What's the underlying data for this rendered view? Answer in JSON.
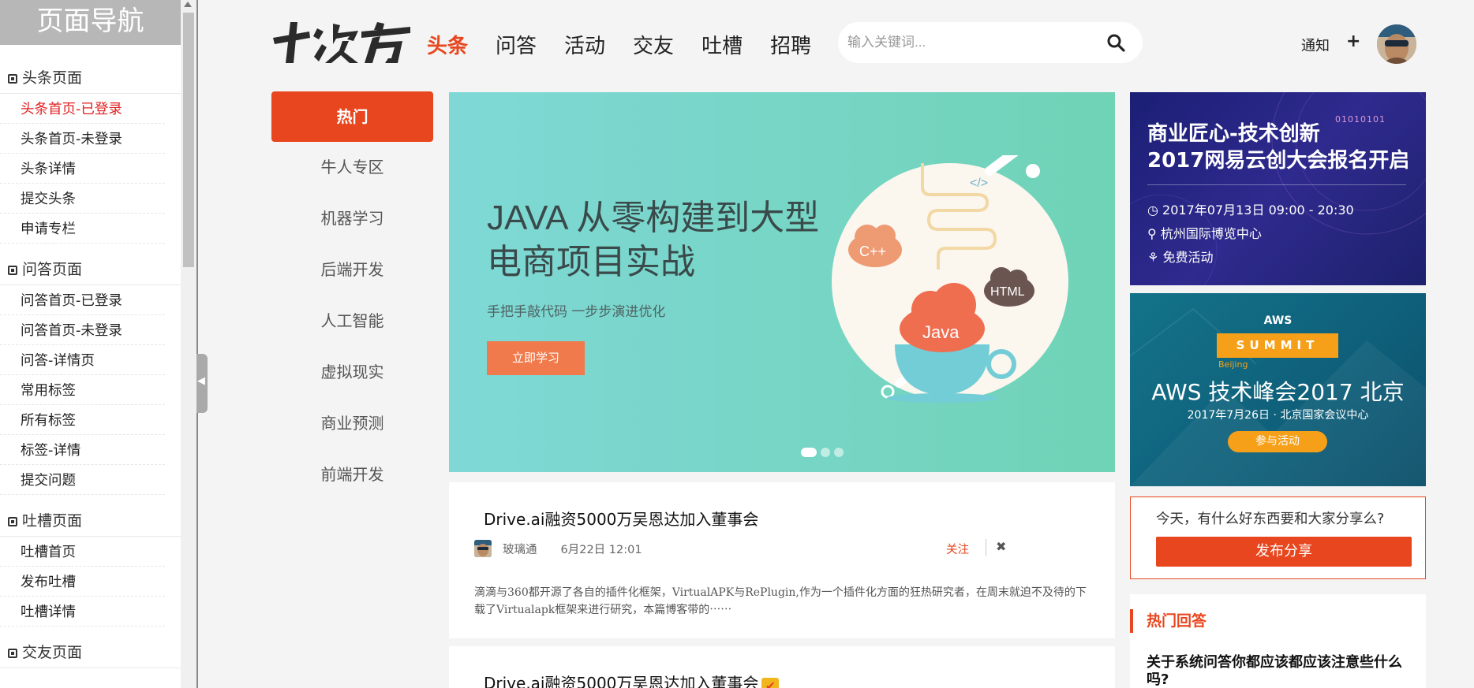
{
  "sidenav": {
    "title": "页面导航",
    "sections": [
      {
        "title": "头条页面",
        "items": [
          "头条首页-已登录",
          "头条首页-未登录",
          "头条详情",
          "提交头条",
          "申请专栏"
        ]
      },
      {
        "title": "问答页面",
        "items": [
          "问答首页-已登录",
          "问答首页-未登录",
          "问答-详情页",
          "常用标签",
          "所有标签",
          "标签-详情",
          "提交问题"
        ]
      },
      {
        "title": "吐槽页面",
        "items": [
          "吐槽首页",
          "发布吐槽",
          "吐槽详情"
        ]
      },
      {
        "title": "交友页面"
      }
    ]
  },
  "header": {
    "logo_text": "十次方",
    "nav": [
      "头条",
      "问答",
      "活动",
      "交友",
      "吐槽",
      "招聘"
    ],
    "search_placeholder": "输入关键词...",
    "notify": "通知",
    "plus": "+"
  },
  "categories": {
    "hot": "热门",
    "items": [
      "牛人专区",
      "机器学习",
      "后端开发",
      "人工智能",
      "虚拟现实",
      "商业预测",
      "前端开发"
    ]
  },
  "banner": {
    "title_line1": "JAVA 从零构建到大型",
    "title_line2": "电商项目实战",
    "subtitle": "手把手敲代码  一步步演进优化",
    "button": "立即学习",
    "cloud_cpp": "C++",
    "cloud_java": "Java",
    "cloud_html": "HTML",
    "code_tag": "</>"
  },
  "articles": [
    {
      "title": "Drive.ai融资5000万吴恩达加入董事会",
      "author": "玻璃通",
      "date": "6月22日 12:01",
      "follow": "关注",
      "dismiss": "✖",
      "body": "滴滴与360都开源了各自的插件化框架，VirtualAPK与RePlugin,作为一个插件化方面的狂热研究者，在周末就迫不及待的下载了Virtualapk框架来进行研究，本篇博客带的⋯⋯"
    },
    {
      "title": "Drive.ai融资5000万吴恩达加入董事会",
      "badge": "✔"
    }
  ],
  "ads": {
    "ad1": {
      "bits": "01010101",
      "title_line1": "商业匠心-技术创新",
      "title_line2": "2017网易云创大会报名开启",
      "time": "2017年07月13日 09:00 - 20:30",
      "place": "杭州国际博览中心",
      "free": "免费活动"
    },
    "ad2": {
      "label": "AWS",
      "summit": "SUMMIT",
      "small": "Beijing",
      "title": "AWS 技术峰会2017 北京",
      "sub": "2017年7月26日 · 北京国家会议中心",
      "button": "参与活动"
    }
  },
  "share": {
    "prompt": "今天，有什么好东西要和大家分享么?",
    "button": "发布分享"
  },
  "hot_answers": {
    "title": "热门回答",
    "question": "关于系统问答你都应该都应该注意些什么吗?"
  },
  "colors": {
    "accent": "#e8461e",
    "banner": "#7fd8d6"
  }
}
